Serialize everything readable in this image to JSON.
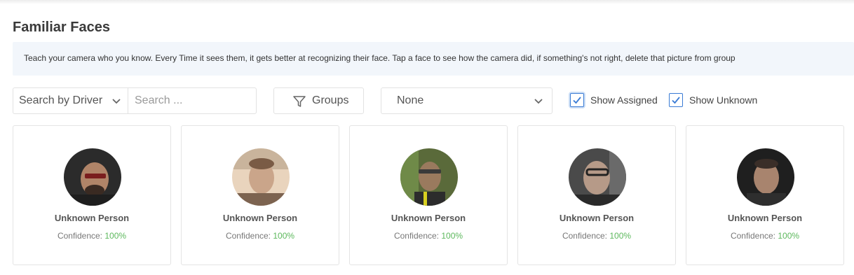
{
  "page": {
    "title": "Familiar Faces",
    "info": "Teach your camera who you know. Every Time it sees them, it gets better at recognizing their face. Tap a face to see how the camera did, if something's not right, delete that picture from group"
  },
  "filters": {
    "search_by": "Search by Driver",
    "search_placeholder": "Search ...",
    "groups_label": "Groups",
    "group_select": "None",
    "show_assigned": "Show Assigned",
    "show_unknown": "Show Unknown"
  },
  "faces": [
    {
      "name": "Unknown Person",
      "confidence_label": "Confidence:",
      "confidence": "100%"
    },
    {
      "name": "Unknown Person",
      "confidence_label": "Confidence:",
      "confidence": "100%"
    },
    {
      "name": "Unknown Person",
      "confidence_label": "Confidence:",
      "confidence": "100%"
    },
    {
      "name": "Unknown Person",
      "confidence_label": "Confidence:",
      "confidence": "100%"
    },
    {
      "name": "Unknown Person",
      "confidence_label": "Confidence:",
      "confidence": "100%"
    }
  ],
  "colors": {
    "accent": "#3a7bd5",
    "confidence_green": "#5cb85c",
    "banner_bg": "#f2f6fb"
  },
  "icons": {
    "search_by_chevron": "chevron-down-icon",
    "groups": "filter-icon",
    "group_select_chevron": "chevron-down-icon",
    "checkbox": "checkmark-icon"
  }
}
